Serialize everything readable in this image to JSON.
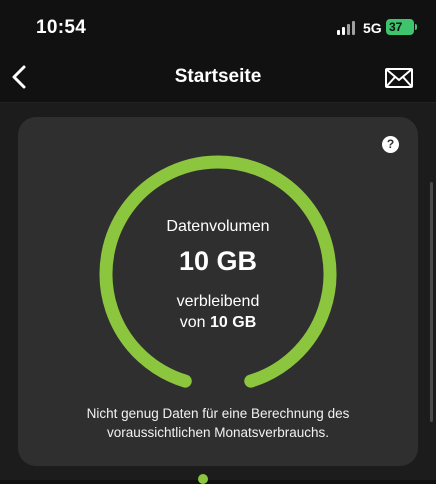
{
  "status_bar": {
    "time": "10:54",
    "network": "5G",
    "battery": "37",
    "battery_color": "#3ec46d"
  },
  "nav": {
    "title": "Startseite",
    "back_icon": "chevron-left-icon",
    "mail_icon": "envelope-icon"
  },
  "card": {
    "help_symbol": "?",
    "label": "Datenvolumen",
    "value": "10 GB",
    "remaining_label": "verbleibend",
    "of_prefix": "von",
    "of_total": "10 GB",
    "remaining_fraction": 1.0,
    "gauge_color": "#8cc63f",
    "note": "Nicht genug Daten für eine Berechnung des voraussichtlichen Monatsverbrauchs."
  }
}
